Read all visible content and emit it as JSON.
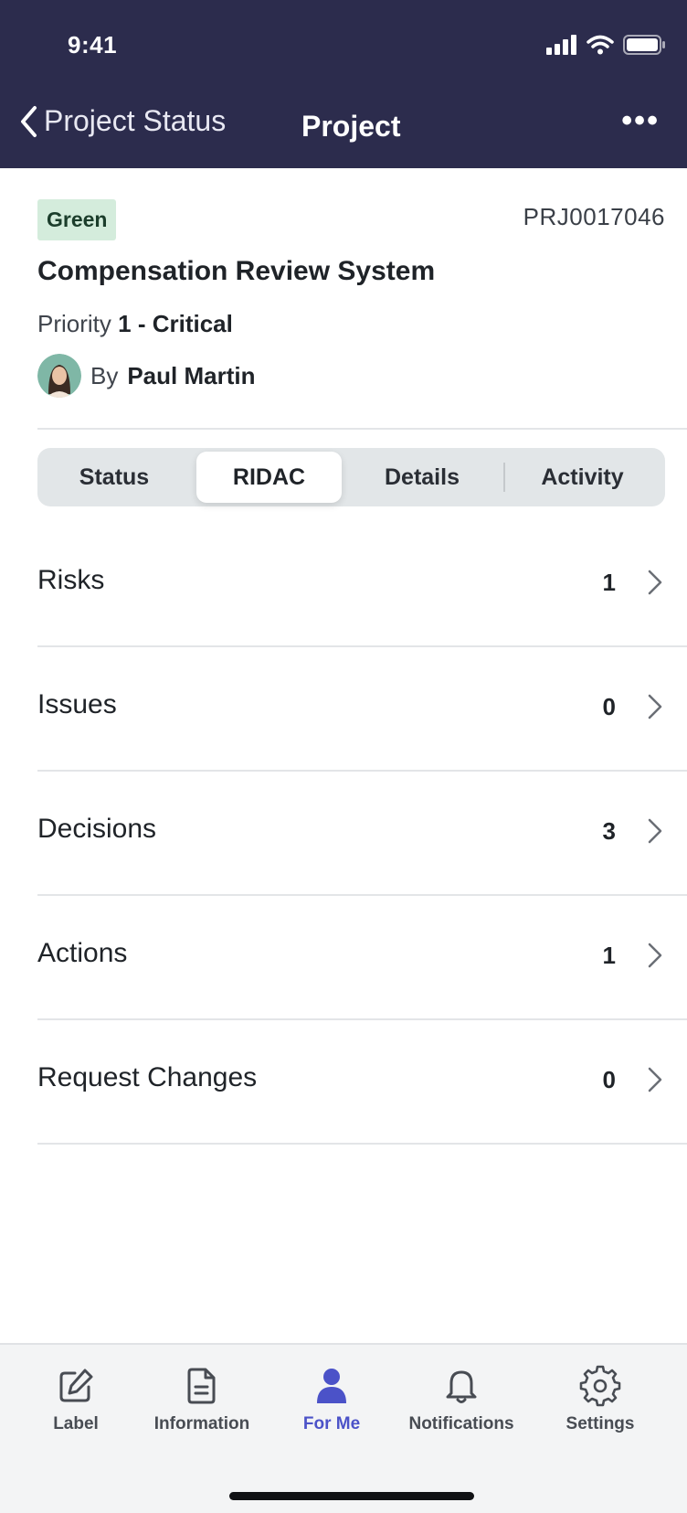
{
  "status_bar": {
    "time": "9:41"
  },
  "nav": {
    "back_label": "Project Status",
    "title": "Project"
  },
  "project": {
    "status_badge": "Green",
    "id": "PRJ0017046",
    "name": "Compensation Review System",
    "priority_label": "Priority",
    "priority_value": "1 - Critical",
    "by_label": "By",
    "owner": "Paul Martin"
  },
  "segments": [
    {
      "label": "Status"
    },
    {
      "label": "RIDAC",
      "active": true
    },
    {
      "label": "Details"
    },
    {
      "label": "Activity"
    }
  ],
  "ridac_list": [
    {
      "label": "Risks",
      "count": "1"
    },
    {
      "label": "Issues",
      "count": "0"
    },
    {
      "label": "Decisions",
      "count": "3"
    },
    {
      "label": "Actions",
      "count": "1"
    },
    {
      "label": "Request Changes",
      "count": "0"
    }
  ],
  "tabbar": {
    "items": [
      {
        "label": "Label",
        "icon": "edit-icon"
      },
      {
        "label": "Information",
        "icon": "document-icon"
      },
      {
        "label": "For Me",
        "icon": "person-icon",
        "active": true
      },
      {
        "label": "Notifications",
        "icon": "bell-icon"
      },
      {
        "label": "Settings",
        "icon": "gear-icon"
      }
    ]
  },
  "colors": {
    "header_bg": "#2c2c4d",
    "badge_bg": "#d4ecdc",
    "active_tab": "#4b52c8",
    "segment_bg": "#e2e6e8"
  }
}
